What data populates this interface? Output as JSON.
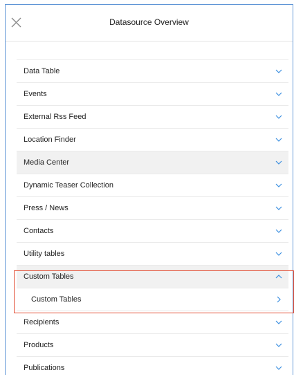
{
  "header": {
    "title": "Datasource Overview",
    "close_icon": "close-icon"
  },
  "colors": {
    "accent": "#3b8fe0",
    "highlight": "#e2492f",
    "frame": "#5f95d6"
  },
  "list": {
    "items": [
      {
        "label": "Data Table",
        "state": "collapsed"
      },
      {
        "label": "Events",
        "state": "collapsed"
      },
      {
        "label": "External Rss Feed",
        "state": "collapsed"
      },
      {
        "label": "Location Finder",
        "state": "collapsed"
      },
      {
        "label": "Media Center",
        "state": "collapsed"
      },
      {
        "label": "Dynamic Teaser Collection",
        "state": "collapsed"
      },
      {
        "label": "Press / News",
        "state": "collapsed"
      },
      {
        "label": "Contacts",
        "state": "collapsed"
      },
      {
        "label": "Utility tables",
        "state": "collapsed"
      },
      {
        "label": "Custom Tables",
        "state": "expanded"
      },
      {
        "label": "Custom Tables",
        "state": "child"
      },
      {
        "label": "Recipients",
        "state": "collapsed"
      },
      {
        "label": "Products",
        "state": "collapsed"
      },
      {
        "label": "Publications",
        "state": "collapsed"
      }
    ]
  }
}
